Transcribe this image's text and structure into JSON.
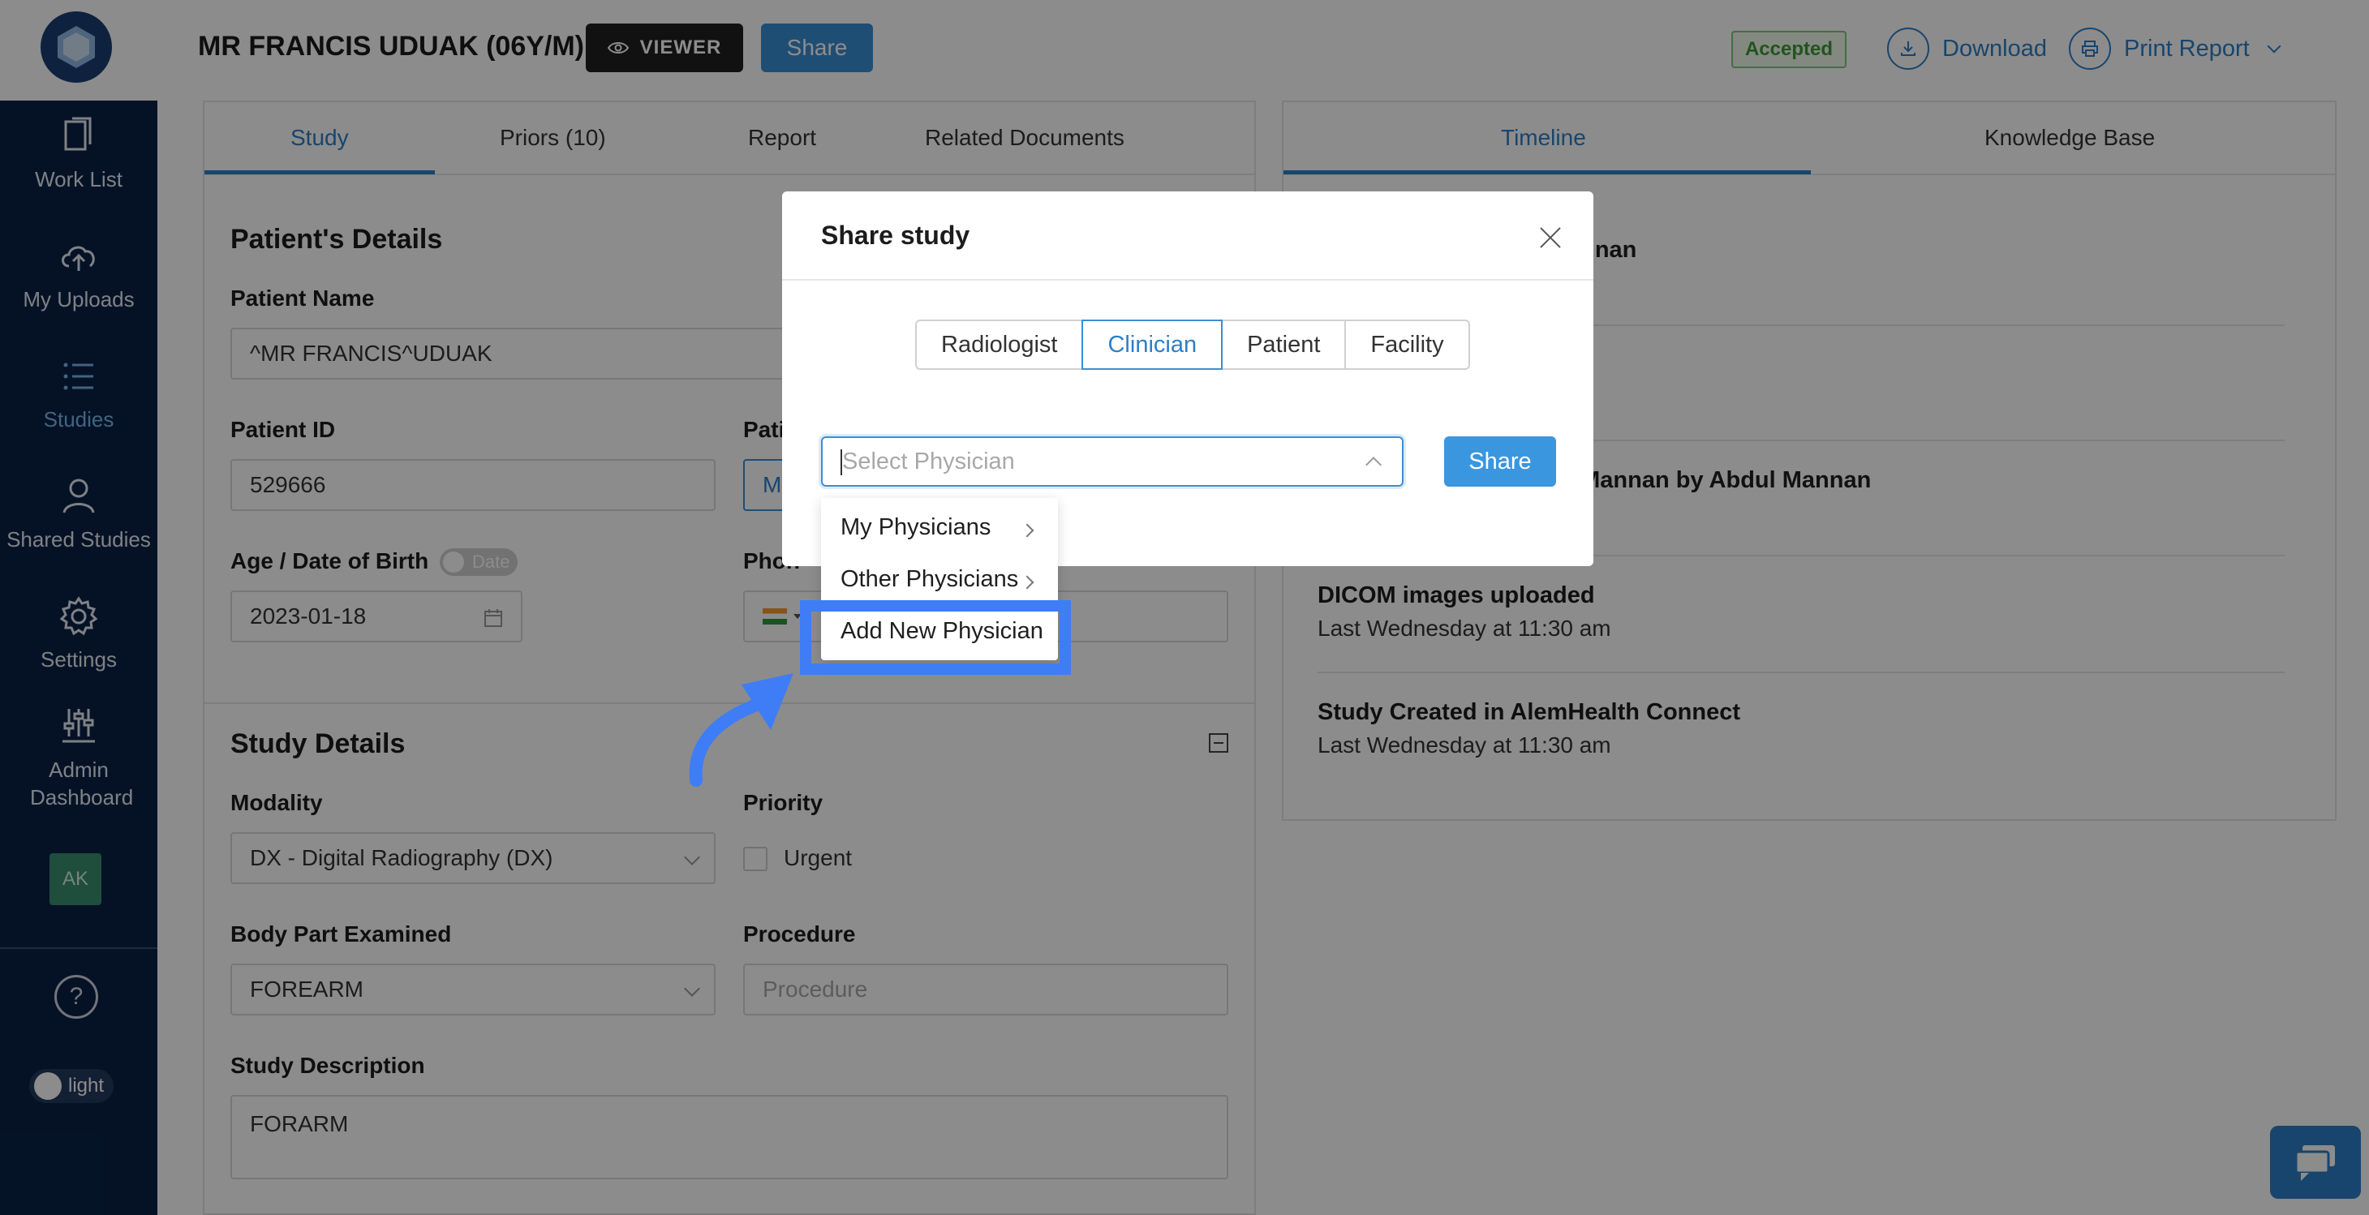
{
  "header": {
    "patient_title": "MR FRANCIS UDUAK (06Y/M)",
    "viewer_label": "VIEWER",
    "share_label": "Share",
    "status_badge": "Accepted",
    "download_label": "Download",
    "print_label": "Print Report"
  },
  "sidebar": {
    "items": [
      {
        "label": "Work List",
        "icon": "worklist-icon"
      },
      {
        "label": "My Uploads",
        "icon": "upload-cloud-icon"
      },
      {
        "label": "Studies",
        "icon": "list-icon"
      },
      {
        "label": "Shared Studies",
        "icon": "user-icon"
      },
      {
        "label": "Settings",
        "icon": "gear-icon"
      },
      {
        "label": "Admin Dashboard",
        "icon": "sliders-icon"
      }
    ],
    "active_item": "Studies",
    "avatar_initials": "AK",
    "theme_label": "light"
  },
  "left_tabs": [
    "Study",
    "Priors (10)",
    "Report",
    "Related Documents"
  ],
  "patient_details": {
    "section_title": "Patient's Details",
    "name_label": "Patient Name",
    "name_value": "^MR FRANCIS^UDUAK",
    "id_label": "Patient ID",
    "id_value": "529666",
    "pati_label_partial": "Pati",
    "m_partial": "M",
    "age_label": "Age / Date of Birth",
    "date_toggle_label": "Date",
    "dob_value": "2023-01-18",
    "phone_label_partial": "Phon"
  },
  "study_details": {
    "section_title": "Study Details",
    "modality_label": "Modality",
    "modality_value": "DX - Digital Radiography (DX)",
    "priority_label": "Priority",
    "urgent_label": "Urgent",
    "body_part_label": "Body Part Examined",
    "body_part_value": "FOREARM",
    "procedure_label": "Procedure",
    "procedure_placeholder": "Procedure",
    "description_label": "Study Description",
    "description_value": "FORARM"
  },
  "right_tabs": [
    "Timeline",
    "Knowledge Base"
  ],
  "timeline": [
    {
      "title": "...annan",
      "sub": "...m"
    },
    {
      "title": "",
      "sub": "...m"
    },
    {
      "title": "...l Mannan by Abdul Mannan",
      "sub": "...m"
    },
    {
      "title": "DICOM images uploaded",
      "sub": "Last Wednesday at 11:30 am"
    },
    {
      "title": "Study Created in AlemHealth Connect",
      "sub": "Last Wednesday at 11:30 am"
    }
  ],
  "timeline_fragments": {
    "t1_title": "annan",
    "t1_sub": "m",
    "t2_sub": "m",
    "t3_title": "l Mannan by Abdul Mannan",
    "t3_sub": "m"
  },
  "modal": {
    "title": "Share study",
    "segments": [
      "Radiologist",
      "Clinician",
      "Patient",
      "Facility"
    ],
    "active_segment": "Clinician",
    "select_placeholder": "Select Physician",
    "share_label": "Share"
  },
  "dropdown": {
    "items": [
      "My Physicians",
      "Other Physicians",
      "Add New Physician"
    ],
    "highlighted_item": "Add New Physician"
  },
  "colors": {
    "accent": "#2d7fc6",
    "sidebar": "#0a2246",
    "highlight": "#3e7df5",
    "accepted": "#3c9a35"
  }
}
